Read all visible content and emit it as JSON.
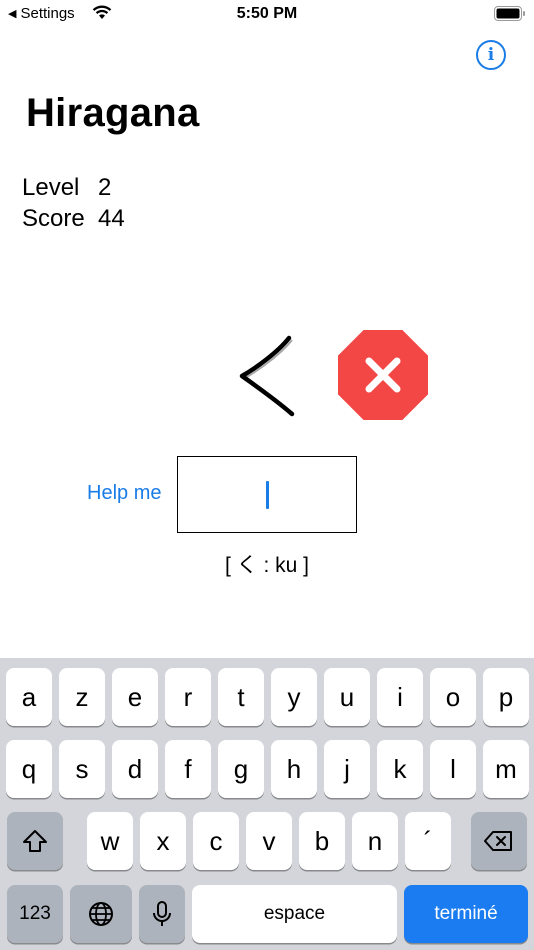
{
  "status_bar": {
    "back_label": "Settings",
    "time": "5:50 PM"
  },
  "header": {
    "title": "Hiragana"
  },
  "stats": {
    "level_label": "Level",
    "level_value": "2",
    "score_label": "Score",
    "score_value": "44"
  },
  "quiz": {
    "kana": "く",
    "result": "wrong",
    "help_label": "Help me",
    "answer_value": "",
    "hint": "[ く : ku ]"
  },
  "colors": {
    "accent": "#1a7ce6",
    "error": "#f24745",
    "keyboard_bg": "#d3d5db"
  },
  "keyboard": {
    "row1": [
      "a",
      "z",
      "e",
      "r",
      "t",
      "y",
      "u",
      "i",
      "o",
      "p"
    ],
    "row2": [
      "q",
      "s",
      "d",
      "f",
      "g",
      "h",
      "j",
      "k",
      "l",
      "m"
    ],
    "row3": [
      "w",
      "x",
      "c",
      "v",
      "b",
      "n",
      "´"
    ],
    "numbers_label": "123",
    "space_label": "espace",
    "done_label": "terminé",
    "shift_icon": "shift-icon",
    "delete_icon": "delete-icon",
    "globe_icon": "globe-icon",
    "mic_icon": "microphone-icon"
  }
}
